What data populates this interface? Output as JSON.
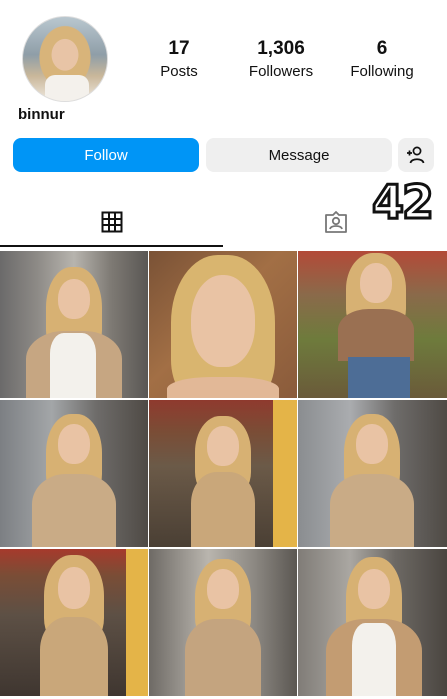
{
  "profile": {
    "username": "binnur",
    "posts_count": "17",
    "posts_label": "Posts",
    "followers_count": "1,306",
    "followers_label": "Followers",
    "following_count": "6",
    "following_label": "Following"
  },
  "actions": {
    "follow_label": "Follow",
    "message_label": "Message",
    "add_user_icon": "add-user-icon"
  },
  "tabs": {
    "grid_icon": "grid-icon",
    "tagged_icon": "tagged-icon",
    "active": "grid"
  },
  "overlay_text": "42",
  "colors": {
    "accent": "#0095f6",
    "secondary_button": "#efefef"
  },
  "posts": [
    {
      "scene": "street, beige coat, white top"
    },
    {
      "scene": "close-up portrait"
    },
    {
      "scene": "market, brown crop top, jeans"
    },
    {
      "scene": "street, beige trench coat"
    },
    {
      "scene": "cafe, sleeveless beige dress"
    },
    {
      "scene": "street, beige trench coat"
    },
    {
      "scene": "cafe, sleeveless beige dress"
    },
    {
      "scene": "street, beige outfit"
    },
    {
      "scene": "street, beige coat, white top"
    }
  ]
}
